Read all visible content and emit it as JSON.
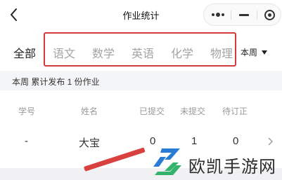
{
  "navbar": {
    "title": "作业统计",
    "icons": [
      "back-arrow-icon",
      "more-dots-icon",
      "minimize-icon",
      "target-icon"
    ]
  },
  "tabs": {
    "items": [
      "全部",
      "语文",
      "数学",
      "英语",
      "化学",
      "物理"
    ],
    "active_index": 0
  },
  "week_filter": {
    "label": "本周"
  },
  "summary": {
    "text": "本周 累计发布 1 份作业"
  },
  "table": {
    "headers": [
      "学号",
      "姓名",
      "已提交",
      "未提交",
      "待订正"
    ],
    "rows": [
      {
        "id": "-",
        "name": "大宝",
        "submitted": "0",
        "unsubmitted": "1",
        "to_correct": "0"
      }
    ]
  },
  "watermark": {
    "text": "欧凯手游网"
  },
  "colors": {
    "highlight_box": "#d33a3a",
    "tab_inactive": "#a3a3a3",
    "tab_active": "#222222",
    "watermark_blue": "#2a7bd4",
    "watermark_green": "#33b36b"
  }
}
